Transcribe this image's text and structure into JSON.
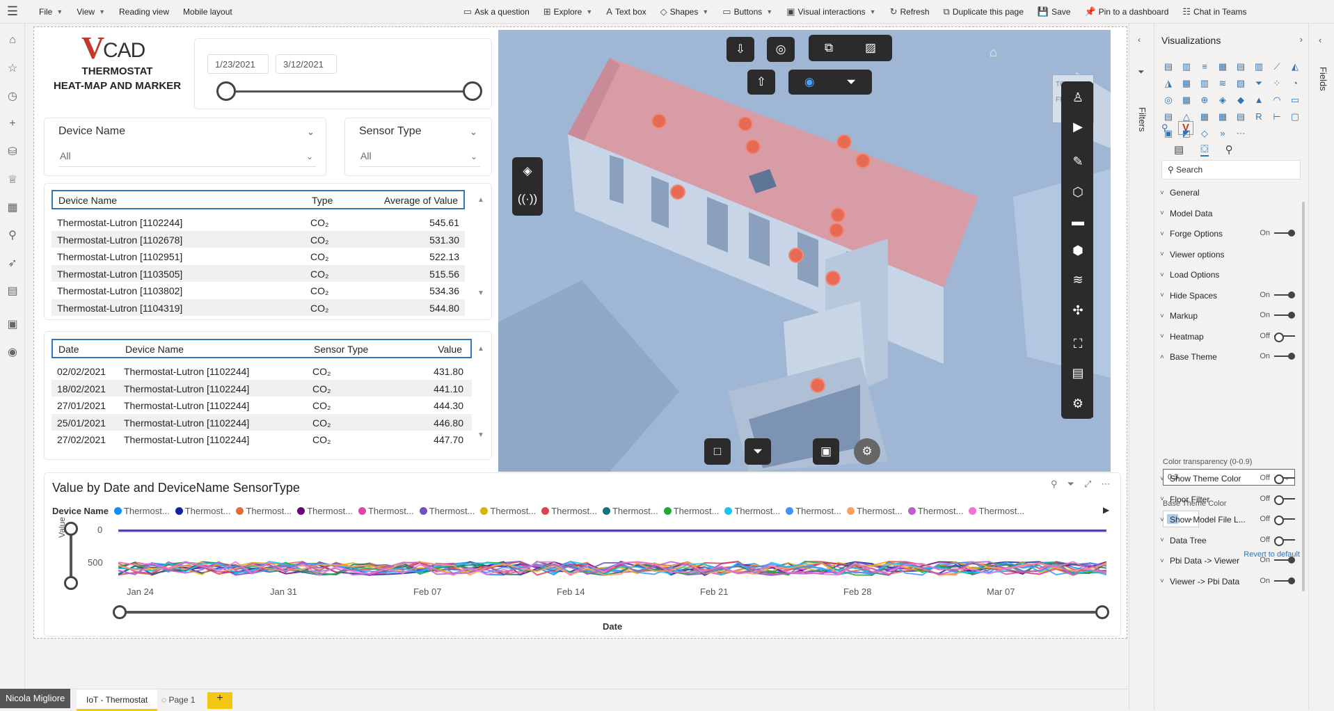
{
  "topbar": {
    "items": [
      "File",
      "View",
      "Reading view",
      "Mobile layout",
      "Ask a question",
      "Explore",
      "Text box",
      "Shapes",
      "Buttons",
      "Visual interactions",
      "Refresh",
      "Duplicate this page",
      "Save",
      "Pin to a dashboard",
      "Chat in Teams"
    ]
  },
  "logo": {
    "brand_v": "V",
    "brand_cad": "CAD",
    "line1": "THERMOSTAT",
    "line2": "HEAT-MAP AND MARKER"
  },
  "date_range": {
    "start": "1/23/2021",
    "end": "3/12/2021"
  },
  "slicers": {
    "device": {
      "title": "Device Name",
      "value": "All"
    },
    "sensor": {
      "title": "Sensor Type",
      "value": "All"
    }
  },
  "table1": {
    "headers": [
      "Device Name",
      "Type",
      "Average of Value"
    ],
    "rows": [
      [
        "Thermostat-Lutron [1102244]",
        "CO₂",
        "545.61"
      ],
      [
        "Thermostat-Lutron [1102678]",
        "CO₂",
        "531.30"
      ],
      [
        "Thermostat-Lutron [1102951]",
        "CO₂",
        "522.13"
      ],
      [
        "Thermostat-Lutron [1103505]",
        "CO₂",
        "515.56"
      ],
      [
        "Thermostat-Lutron [1103802]",
        "CO₂",
        "534.36"
      ],
      [
        "Thermostat-Lutron [1104319]",
        "CO₂",
        "544.80"
      ]
    ]
  },
  "table2": {
    "headers": [
      "Date",
      "Device Name",
      "Sensor Type",
      "Value"
    ],
    "rows": [
      [
        "02/02/2021",
        "Thermostat-Lutron [1102244]",
        "CO₂",
        "431.80"
      ],
      [
        "18/02/2021",
        "Thermostat-Lutron [1102244]",
        "CO₂",
        "441.10"
      ],
      [
        "27/01/2021",
        "Thermostat-Lutron [1102244]",
        "CO₂",
        "444.30"
      ],
      [
        "25/01/2021",
        "Thermostat-Lutron [1102244]",
        "CO₂",
        "446.80"
      ],
      [
        "27/02/2021",
        "Thermostat-Lutron [1102244]",
        "CO₂",
        "447.70"
      ]
    ]
  },
  "chart": {
    "title": "Value by Date and DeviceName SensorType",
    "legend_label": "Device Name",
    "legend_item": "Thermost...",
    "ylabel": "Value",
    "xlabel": "Date"
  },
  "chart_data": {
    "type": "line",
    "title": "Value by Date and DeviceName SensorType",
    "xlabel": "Date",
    "ylabel": "Value",
    "y_ticks": [
      "0",
      "500"
    ],
    "x_ticks": [
      "Jan 24",
      "Jan 31",
      "Feb 07",
      "Feb 14",
      "Feb 21",
      "Feb 28",
      "Mar 07"
    ],
    "series_colors": [
      "#118dff",
      "#12239e",
      "#e66c37",
      "#6b007b",
      "#e044a7",
      "#744ec2",
      "#d9b300",
      "#d64550",
      "#197278",
      "#1aab40",
      "#15c6f4",
      "#4092ff",
      "#ffa058",
      "#be5dc9",
      "#f472d0"
    ],
    "series_count": 15,
    "value_range": [
      430,
      620
    ]
  },
  "viz_pane": {
    "title": "Visualizations",
    "search_placeholder": "Search",
    "sections": [
      {
        "label": "General",
        "toggle": ""
      },
      {
        "label": "Model Data",
        "toggle": ""
      },
      {
        "label": "Forge Options",
        "toggle": "On"
      },
      {
        "label": "Viewer options",
        "toggle": ""
      },
      {
        "label": "Load Options",
        "toggle": ""
      },
      {
        "label": "Hide Spaces",
        "toggle": "On"
      },
      {
        "label": "Markup",
        "toggle": "On"
      },
      {
        "label": "Heatmap",
        "toggle": "Off"
      },
      {
        "label": "Base Theme",
        "toggle": "On"
      }
    ],
    "color_transparency_label": "Color transparency (0-0.9)",
    "color_transparency_value": "0.3",
    "base_theme_color_label": "Base Theme Color",
    "revert": "Revert to default",
    "sections2": [
      {
        "label": "Show Theme Color",
        "toggle": "Off"
      },
      {
        "label": "Floor Filter",
        "toggle": "Off"
      },
      {
        "label": "Show Model File L...",
        "toggle": "Off"
      },
      {
        "label": "Data Tree",
        "toggle": "Off"
      },
      {
        "label": "Pbi Data -> Viewer",
        "toggle": "On"
      },
      {
        "label": "Viewer -> Pbi Data",
        "toggle": "On"
      }
    ],
    "filters_label": "Filters",
    "fields_label": "Fields"
  },
  "bottom": {
    "user": "Nicola Migliore",
    "tab1": "IoT - Thermostat",
    "tab2": "Page 1",
    "add": "+"
  }
}
